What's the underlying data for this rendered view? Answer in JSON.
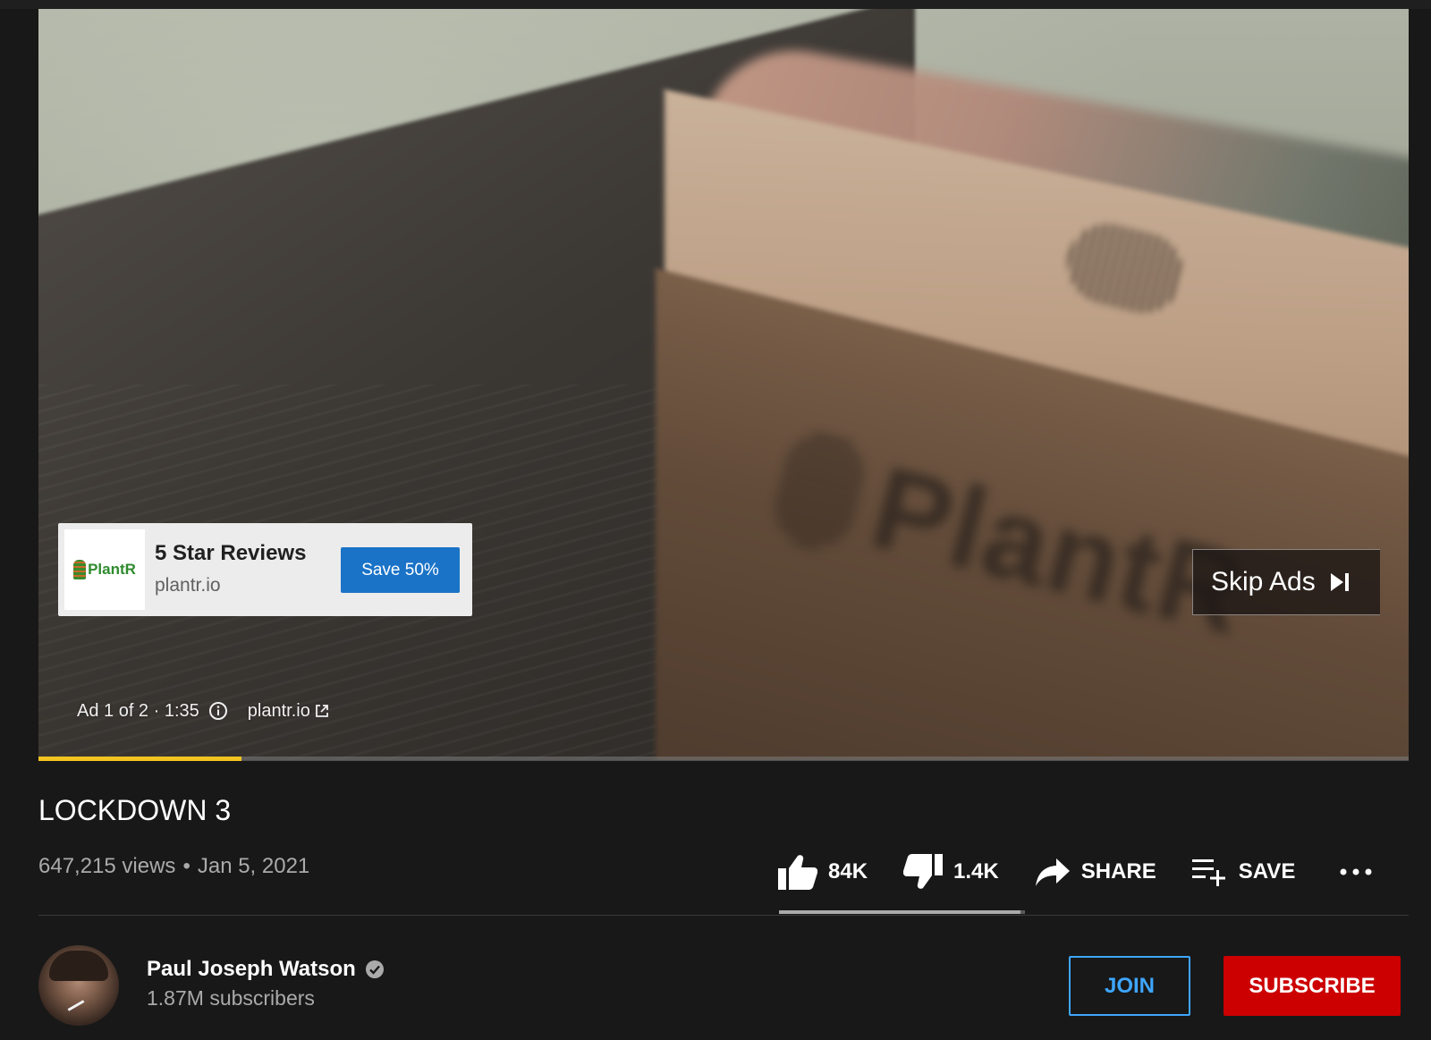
{
  "colors": {
    "progress": "#f2c420",
    "cta_blue": "#1a73c7",
    "join_blue": "#3ea6ff",
    "subscribe_red": "#cc0000",
    "background": "#181818"
  },
  "ad": {
    "logo_text": "PlantR",
    "title": "5 Star Reviews",
    "url": "plantr.io",
    "cta": "Save 50%",
    "skip_label": "Skip Ads",
    "info": "Ad 1 of 2 · 1:35",
    "site_link": "plantr.io",
    "progress_fraction": 0.148
  },
  "video": {
    "title": "LOCKDOWN 3",
    "views": "647,215 views",
    "separator": "•",
    "date": "Jan 5, 2021"
  },
  "actions": {
    "likes": "84K",
    "dislikes": "1.4K",
    "share": "SHARE",
    "save": "SAVE",
    "like_ratio": 0.98
  },
  "channel": {
    "name": "Paul Joseph Watson",
    "subscribers": "1.87M subscribers",
    "join": "JOIN",
    "subscribe": "SUBSCRIBE"
  },
  "icons": [
    "thumbs-up-icon",
    "thumbs-down-icon",
    "share-arrow-icon",
    "playlist-add-icon",
    "more-icon",
    "verified-icon",
    "info-icon",
    "external-link-icon",
    "skip-next-icon"
  ]
}
